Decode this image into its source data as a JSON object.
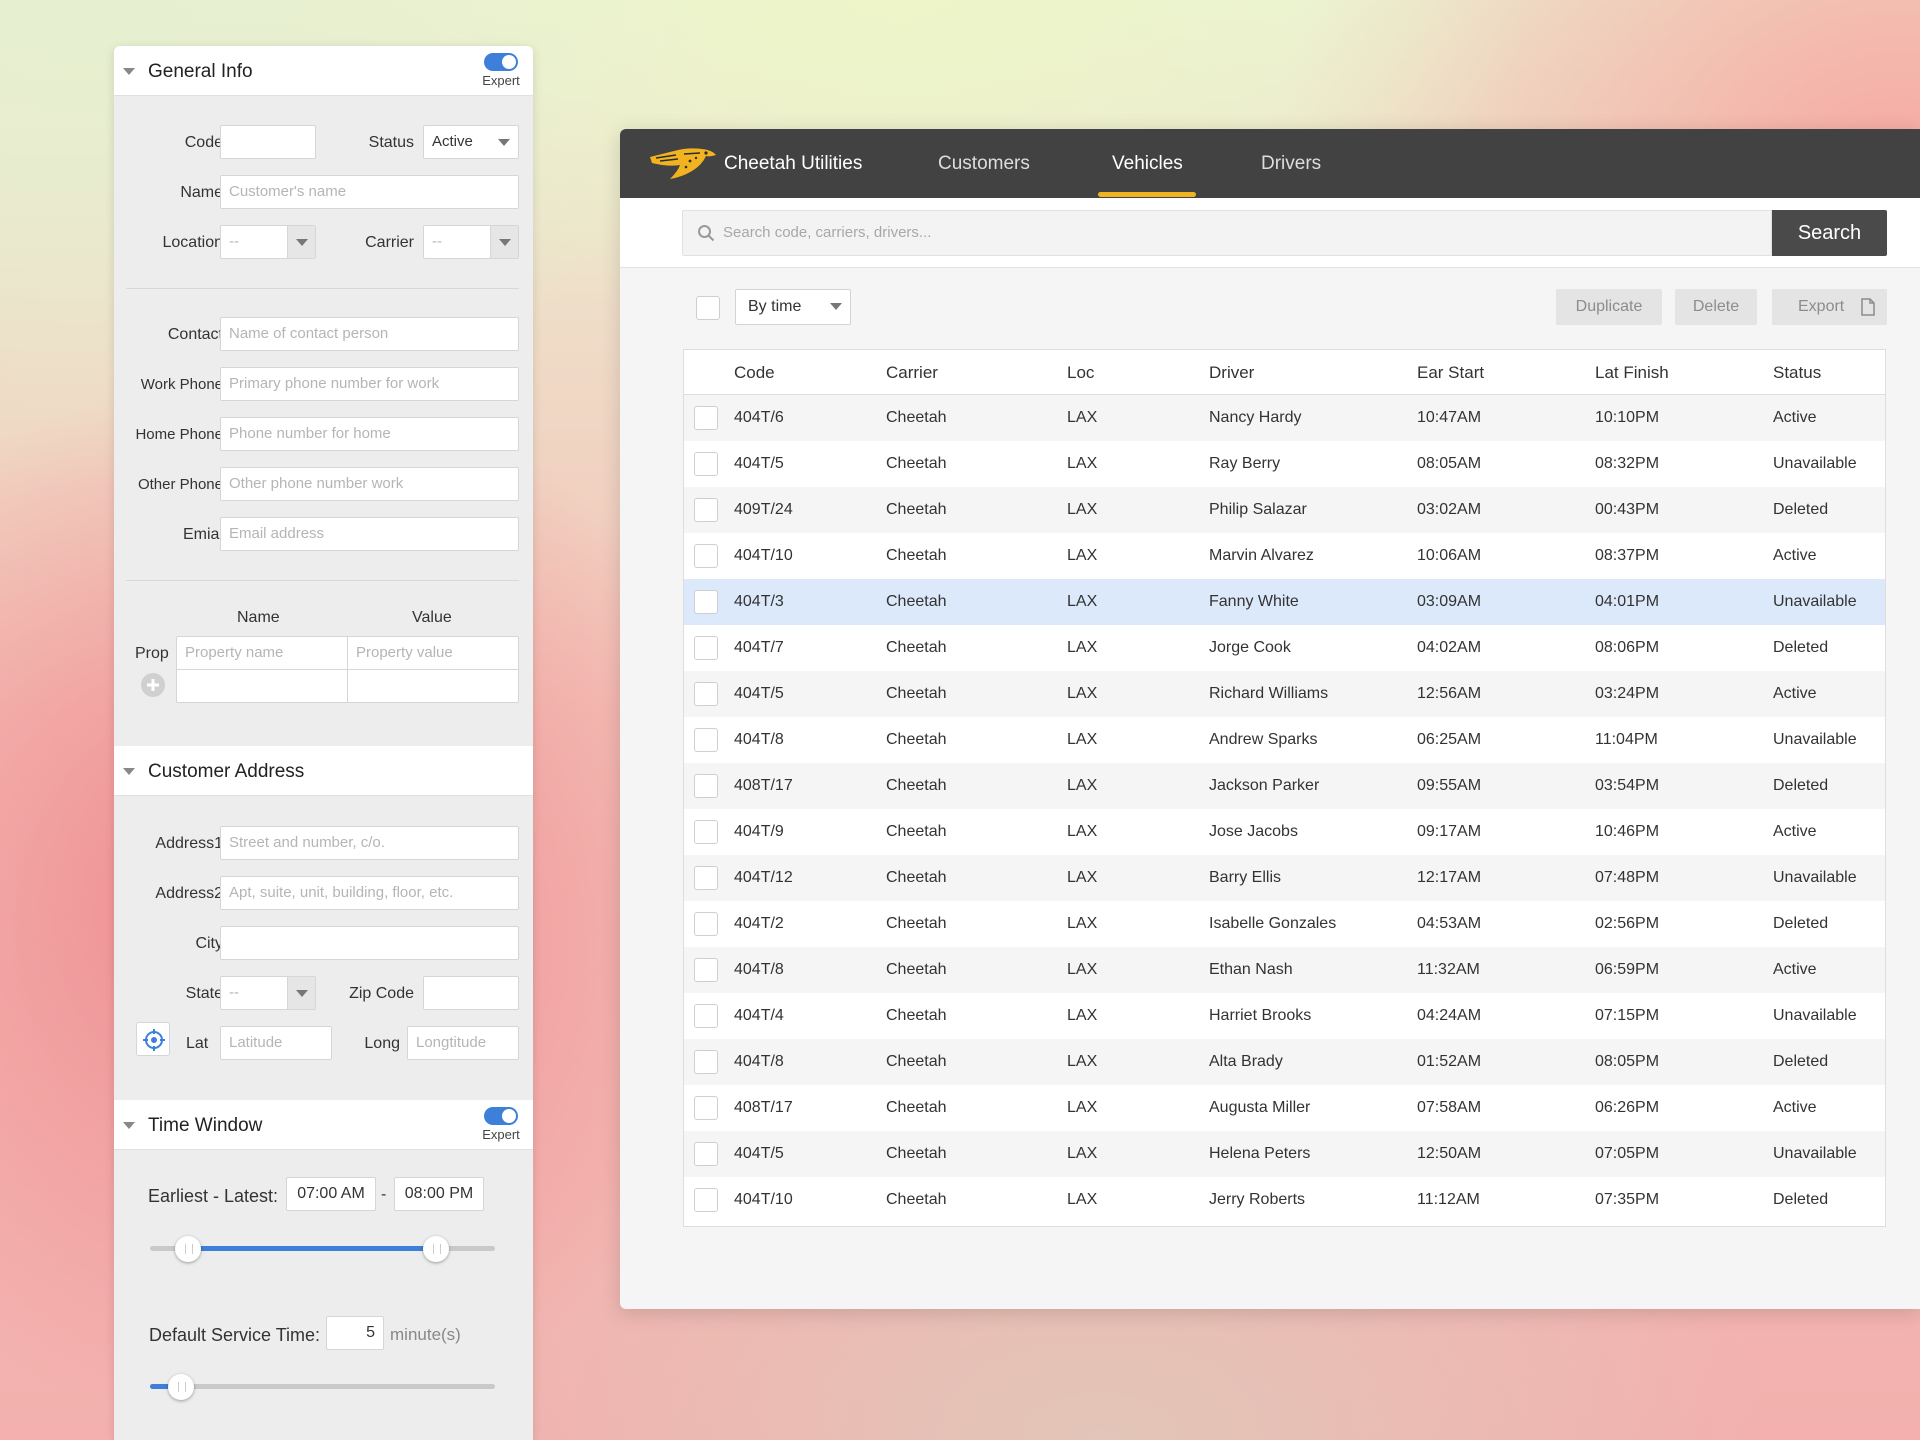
{
  "general_info": {
    "title": "General Info",
    "toggle_label": "Expert",
    "code_label": "Code",
    "code_value": "",
    "status_label": "Status",
    "status_value": "Active",
    "name_label": "Name",
    "name_placeholder": "Customer's name",
    "location_label": "Location",
    "location_value": "--",
    "carrier_label": "Carrier",
    "carrier_value": "--",
    "contact_label": "Contact",
    "contact_placeholder": "Name of contact person",
    "work_phone_label": "Work Phone",
    "work_phone_placeholder": "Primary phone number for work",
    "home_phone_label": "Home Phone",
    "home_phone_placeholder": "Phone number for home",
    "other_phone_label": "Other Phone",
    "other_phone_placeholder": "Other phone number work",
    "email_label": "Emial",
    "email_placeholder": "Email address",
    "prop_name_header": "Name",
    "prop_value_header": "Value",
    "prop_label": "Prop",
    "prop_name_placeholder": "Property name",
    "prop_value_placeholder": "Property value"
  },
  "customer_address": {
    "title": "Customer Address",
    "address1_label": "Address1",
    "address1_placeholder": "Street and number, c/o.",
    "address2_label": "Address2",
    "address2_placeholder": "Apt, suite, unit, building, floor, etc.",
    "city_label": "City",
    "city_value": "",
    "state_label": "State",
    "state_value": "--",
    "zip_label": "Zip Code",
    "zip_value": "",
    "lat_label": "Lat",
    "lat_placeholder": "Latitude",
    "long_label": "Long",
    "long_placeholder": "Longtitude"
  },
  "time_window": {
    "title": "Time Window",
    "toggle_label": "Expert",
    "range_label": "Earliest - Latest:",
    "earliest": "07:00 AM",
    "separator": "-",
    "latest": "08:00 PM",
    "range_slider": {
      "start_fraction": 0.11,
      "end_fraction": 0.83
    },
    "service_label": "Default Service Time:",
    "service_value": "5",
    "service_unit": "minute(s)",
    "service_slider": {
      "fraction": 0.09
    }
  },
  "app": {
    "brand": "Cheetah Utilities",
    "nav": [
      "Customers",
      "Vehicles",
      "Drivers"
    ],
    "active_nav": "Vehicles",
    "accent_color": "#f2b321",
    "search_placeholder": "Search code, carriers, drivers...",
    "search_button": "Search",
    "sort_value": "By time",
    "duplicate_button": "Duplicate",
    "delete_button": "Delete",
    "export_button": "Export"
  },
  "table": {
    "columns": [
      "Code",
      "Carrier",
      "Loc",
      "Driver",
      "Ear Start",
      "Lat Finish",
      "Status"
    ],
    "selected_row": 4,
    "rows": [
      [
        "404T/6",
        "Cheetah",
        "LAX",
        "Nancy Hardy",
        "10:47AM",
        "10:10PM",
        "Active"
      ],
      [
        "404T/5",
        "Cheetah",
        "LAX",
        "Ray Berry",
        "08:05AM",
        "08:32PM",
        "Unavailable"
      ],
      [
        "409T/24",
        "Cheetah",
        "LAX",
        "Philip Salazar",
        "03:02AM",
        "00:43PM",
        "Deleted"
      ],
      [
        "404T/10",
        "Cheetah",
        "LAX",
        "Marvin Alvarez",
        "10:06AM",
        "08:37PM",
        "Active"
      ],
      [
        "404T/3",
        "Cheetah",
        "LAX",
        "Fanny White",
        "03:09AM",
        "04:01PM",
        "Unavailable"
      ],
      [
        "404T/7",
        "Cheetah",
        "LAX",
        "Jorge Cook",
        "04:02AM",
        "08:06PM",
        "Deleted"
      ],
      [
        "404T/5",
        "Cheetah",
        "LAX",
        "Richard Williams",
        "12:56AM",
        "03:24PM",
        "Active"
      ],
      [
        "404T/8",
        "Cheetah",
        "LAX",
        "Andrew Sparks",
        "06:25AM",
        "11:04PM",
        "Unavailable"
      ],
      [
        "408T/17",
        "Cheetah",
        "LAX",
        "Jackson Parker",
        "09:55AM",
        "03:54PM",
        "Deleted"
      ],
      [
        "404T/9",
        "Cheetah",
        "LAX",
        "Jose Jacobs",
        "09:17AM",
        "10:46PM",
        "Active"
      ],
      [
        "404T/12",
        "Cheetah",
        "LAX",
        "Barry Ellis",
        "12:17AM",
        "07:48PM",
        "Unavailable"
      ],
      [
        "404T/2",
        "Cheetah",
        "LAX",
        "Isabelle Gonzales",
        "04:53AM",
        "02:56PM",
        "Deleted"
      ],
      [
        "404T/8",
        "Cheetah",
        "LAX",
        "Ethan Nash",
        "11:32AM",
        "06:59PM",
        "Active"
      ],
      [
        "404T/4",
        "Cheetah",
        "LAX",
        "Harriet Brooks",
        "04:24AM",
        "07:15PM",
        "Unavailable"
      ],
      [
        "404T/8",
        "Cheetah",
        "LAX",
        "Alta Brady",
        "01:52AM",
        "08:05PM",
        "Deleted"
      ],
      [
        "408T/17",
        "Cheetah",
        "LAX",
        "Augusta Miller",
        "07:58AM",
        "06:26PM",
        "Active"
      ],
      [
        "404T/5",
        "Cheetah",
        "LAX",
        "Helena Peters",
        "12:50AM",
        "07:05PM",
        "Unavailable"
      ],
      [
        "404T/10",
        "Cheetah",
        "LAX",
        "Jerry Roberts",
        "11:12AM",
        "07:35PM",
        "Deleted"
      ]
    ]
  }
}
